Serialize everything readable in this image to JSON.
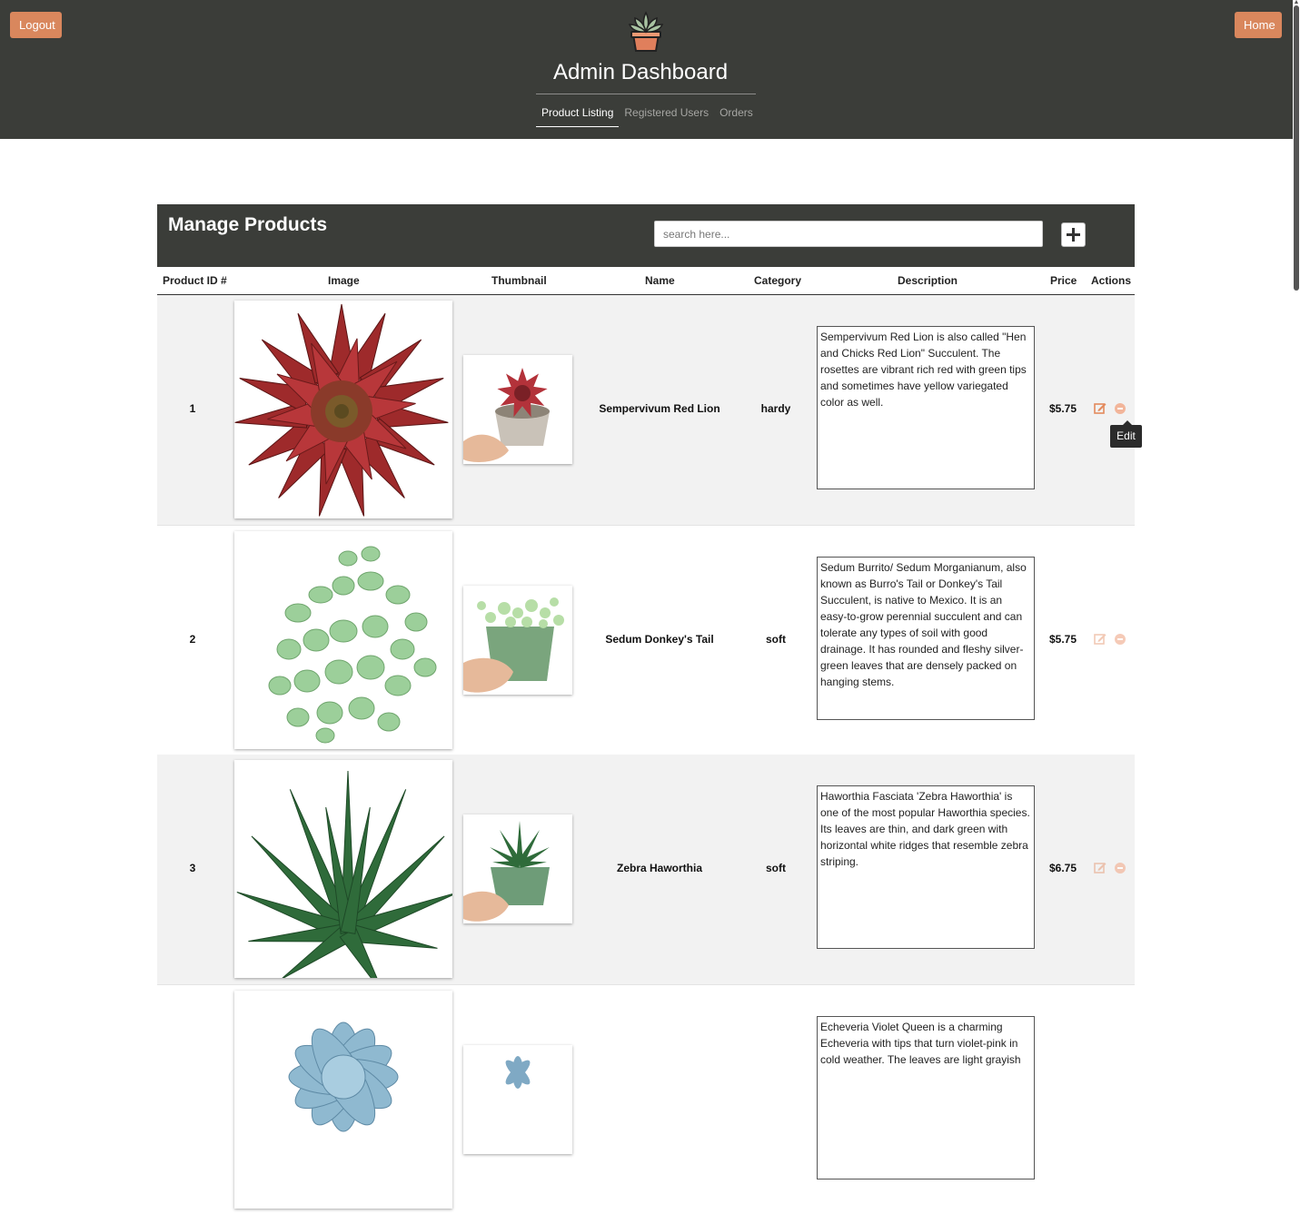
{
  "header": {
    "logout_label": "Logout",
    "home_label": "Home",
    "title": "Admin Dashboard",
    "nav": [
      {
        "label": "Product Listing",
        "active": true
      },
      {
        "label": "Registered Users",
        "active": false
      },
      {
        "label": "Orders",
        "active": false
      }
    ],
    "logo_icon": "succulent-pot-icon"
  },
  "panel": {
    "title": "Manage Products",
    "search_placeholder": "search here...",
    "add_icon": "plus-icon"
  },
  "table": {
    "columns": [
      "Product ID #",
      "Image",
      "Thumbnail",
      "Name",
      "Category",
      "Description",
      "Price",
      "Actions"
    ],
    "rows": [
      {
        "id": "1",
        "name": "Sempervivum Red Lion",
        "category": "hardy",
        "description": "Sempervivum Red Lion is also called \"Hen and Chicks Red Lion\" Succulent. The rosettes are vibrant rich red with green tips and sometimes have yellow variegated color as well.",
        "price": "$5.75",
        "image_icon": "red-succulent-photo"
      },
      {
        "id": "2",
        "name": "Sedum Donkey's Tail",
        "category": "soft",
        "description": "Sedum Burrito/ Sedum Morganianum, also known as Burro's Tail or Donkey's Tail Succulent, is native to Mexico. It is an easy-to-grow perennial succulent and can tolerate any types of soil with good drainage. It has rounded and fleshy silver-green leaves that are densely packed on hanging stems.",
        "price": "$5.75",
        "image_icon": "green-sedum-photo"
      },
      {
        "id": "3",
        "name": "Zebra Haworthia",
        "category": "soft",
        "description": "Haworthia Fasciata 'Zebra Haworthia' is one of the most popular Haworthia species. Its leaves are thin, and dark green with horizontal white ridges that resemble zebra striping.",
        "price": "$6.75",
        "image_icon": "haworthia-photo"
      },
      {
        "id": "",
        "name": "",
        "category": "",
        "description": "Echeveria Violet Queen is a charming Echeveria with tips that turn violet-pink in cold weather. The leaves are light grayish",
        "price": "",
        "image_icon": "blue-echeveria-photo"
      }
    ]
  },
  "tooltip": "Edit",
  "colors": {
    "header_bg": "#3b3d39",
    "accent": "#d9875d",
    "edit_icon": "#e38a5d"
  }
}
